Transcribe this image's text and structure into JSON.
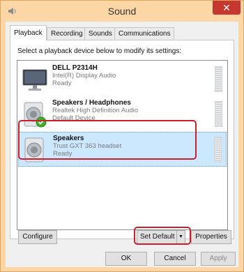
{
  "window": {
    "title": "Sound",
    "close_label": "✕"
  },
  "tabs": [
    {
      "label": "Playback",
      "active": true
    },
    {
      "label": "Recording",
      "active": false
    },
    {
      "label": "Sounds",
      "active": false
    },
    {
      "label": "Communications",
      "active": false
    }
  ],
  "instruction": "Select a playback device below to modify its settings:",
  "devices": [
    {
      "name": "DELL P2314H",
      "driver": "Intel(R) Display Audio",
      "status": "Ready",
      "icon": "monitor-icon",
      "selected": false
    },
    {
      "name": "Speakers / Headphones",
      "driver": "Realtek High Definition Audio",
      "status": "Default Device",
      "icon": "speaker-icon",
      "selected": false,
      "default": true
    },
    {
      "name": "Speakers",
      "driver": "Trust GXT 363 headset",
      "status": "Ready",
      "icon": "speaker-icon",
      "selected": true
    }
  ],
  "buttons": {
    "configure": "Configure",
    "set_default": "Set Default",
    "properties": "Properties",
    "ok": "OK",
    "cancel": "Cancel",
    "apply": "Apply"
  },
  "colors": {
    "highlight": "#c91f2c",
    "selection": "#cce8ff",
    "frame": "#fdd6a6",
    "close": "#c7372f"
  }
}
